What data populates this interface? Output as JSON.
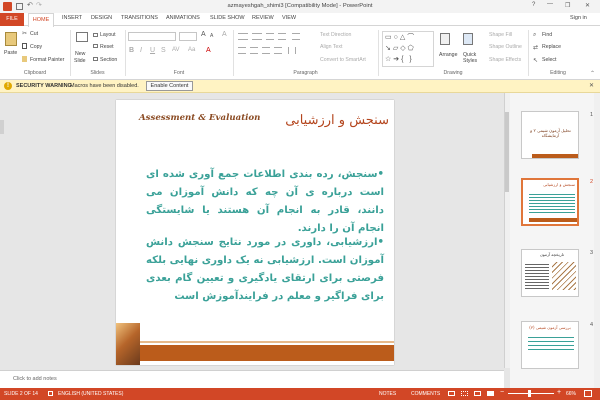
{
  "window": {
    "title": "azmayeshgah_shimi3 [Compatibility Mode] - PowerPoint",
    "signin": "Sign in",
    "help": "?",
    "minimize": "—",
    "restore": "❐",
    "close": "✕"
  },
  "tabs": [
    "FILE",
    "HOME",
    "INSERT",
    "DESIGN",
    "TRANSITIONS",
    "ANIMATIONS",
    "SLIDE SHOW",
    "REVIEW",
    "VIEW"
  ],
  "ribbon": {
    "clipboard": {
      "label": "Clipboard",
      "paste": "Paste",
      "cut": "Cut",
      "copy": "Copy",
      "format_painter": "Format Painter"
    },
    "slides": {
      "label": "Slides",
      "new_slide": "New",
      "new_slide2": "Slide",
      "layout": "Layout",
      "reset": "Reset",
      "section": "Section"
    },
    "font": {
      "label": "Font"
    },
    "paragraph": {
      "label": "Paragraph",
      "text_direction": "Text Direction",
      "align_text": "Align Text",
      "convert": "Convert to SmartArt"
    },
    "drawing": {
      "label": "Drawing",
      "arrange": "Arrange",
      "quick_styles": "Quick",
      "quick_styles2": "Styles",
      "shape_fill": "Shape Fill",
      "shape_outline": "Shape Outline",
      "shape_effects": "Shape Effects"
    },
    "editing": {
      "label": "Editing",
      "find": "Find",
      "replace": "Replace",
      "select": "Select"
    }
  },
  "security": {
    "title": "SECURITY WARNING",
    "message": "Macros have been disabled.",
    "button": "Enable Content",
    "close": "✕"
  },
  "slide": {
    "title": "سنجش و ارزشیابی",
    "subtitle": "Assessment & Evaluation",
    "paragraph1": "•سنجش، رده بندی اطلاعات جمع آوری شده ای است درباره ی آن چه که دانش آموزان می دانند، قادر به انجام آن هستند یا شایستگی انجام آن را دارند.",
    "paragraph2": "•ارزشیابی، داوری در مورد نتایج سنجش دانش آموزان است. ارزشیابی نه یک داوری نهایی بلکه فرصتی برای ارتقای یادگیری و تعیین گام بعدی برای فراگیر و معلم در فرایندآموزش است"
  },
  "thumbnails": [
    {
      "num": "1",
      "caption": "تحلیل آزمون شیمی ۲ و آزمایشگاه"
    },
    {
      "num": "2",
      "caption": "سنجش و ارزشیابی"
    },
    {
      "num": "3",
      "caption": "تاریخچه آزمون"
    },
    {
      "num": "4",
      "caption": "بررسی آزمون شیمی (۳)"
    }
  ],
  "notes": {
    "placeholder": "Click to add notes"
  },
  "status": {
    "slide": "SLIDE 2 OF 14",
    "language": "ENGLISH (UNITED STATES)",
    "notes": "NOTES",
    "comments": "COMMENTS",
    "zoom": "66%"
  },
  "colors": {
    "accent": "#d24726",
    "body_text": "#3aa198",
    "title_text": "#b4451d"
  }
}
